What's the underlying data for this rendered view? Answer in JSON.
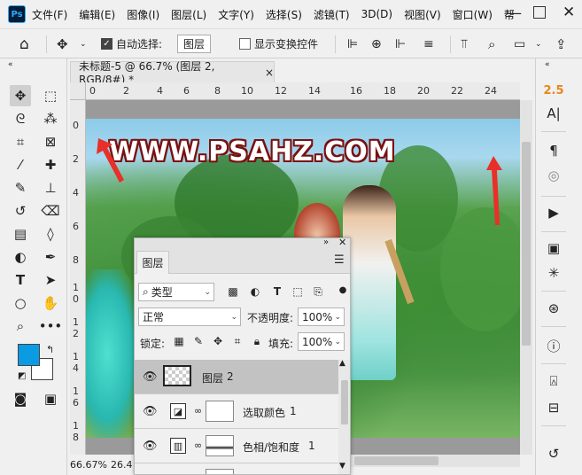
{
  "app": {
    "logo": "Ps"
  },
  "menu": [
    "文件(F)",
    "编辑(E)",
    "图像(I)",
    "图层(L)",
    "文字(Y)",
    "选择(S)",
    "滤镜(T)",
    "3D(D)",
    "视图(V)",
    "窗口(W)",
    "帮"
  ],
  "options_bar": {
    "auto_select_label": "自动选择:",
    "auto_select_value": "图层",
    "show_transform_label": "显示变换控件"
  },
  "document": {
    "tab_title": "未标题-5 @ 66.7% (图层 2, RGB/8#) *",
    "ruler_h": [
      "0",
      "2",
      "4",
      "6",
      "8",
      "10",
      "12",
      "14",
      "16",
      "18",
      "20",
      "22",
      "24"
    ],
    "ruler_v": [
      "0",
      "2",
      "4",
      "6",
      "8",
      "1",
      "0",
      "1",
      "2",
      "1",
      "4",
      "1",
      "6",
      "1",
      "8"
    ],
    "photo_title": "WWW.PSAHZ.COM",
    "status_zoom": "66.67%",
    "status_info": "26.4"
  },
  "right_panel": {
    "char_size": "2.5"
  },
  "colors": {
    "foreground": "#0a9be3",
    "background": "#ffffff",
    "accent_orange": "#e8861b",
    "annotation_red": "#e8302a"
  },
  "layers_panel": {
    "tab": "图层",
    "filter_label": "类型",
    "blend_mode": "正常",
    "opacity_label": "不透明度:",
    "opacity_value": "100%",
    "lock_label": "锁定:",
    "fill_label": "填充:",
    "fill_value": "100%",
    "layers": [
      {
        "name": "图层",
        "num": "2",
        "selected": true
      },
      {
        "name": "选取颜色",
        "num": "1",
        "selected": false
      },
      {
        "name": "色相/饱和度",
        "num": "1",
        "selected": false
      }
    ]
  }
}
